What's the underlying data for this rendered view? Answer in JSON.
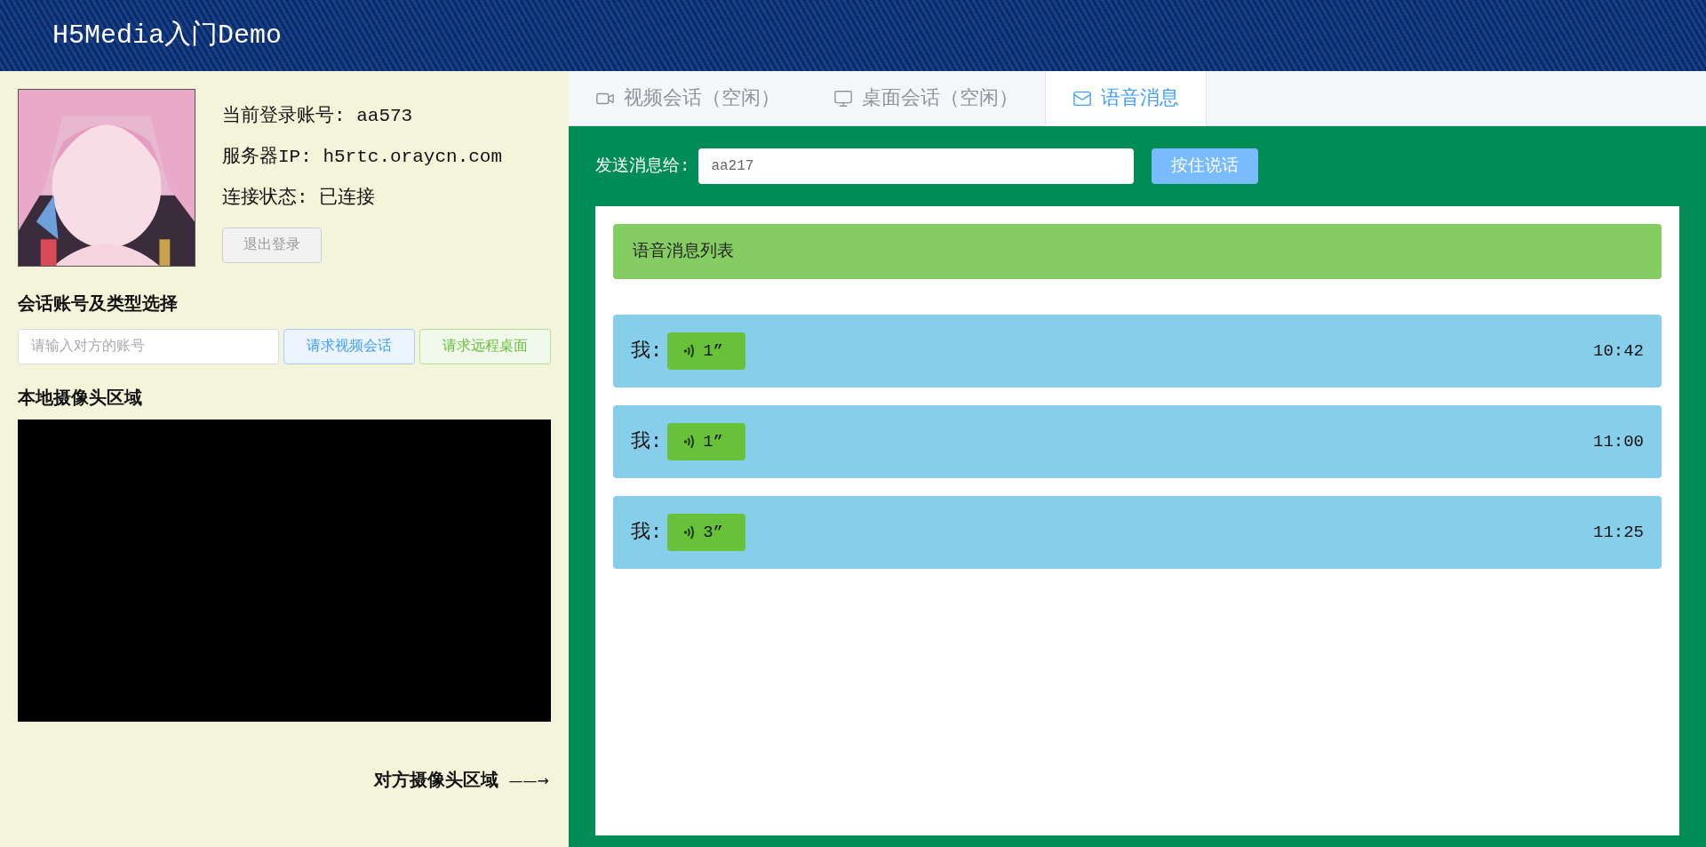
{
  "header": {
    "title": "H5Media入门Demo"
  },
  "account": {
    "info": [
      "当前登录账号: aa573",
      "服务器IP: h5rtc.oraycn.com",
      "连接状态: 已连接"
    ],
    "logout_button": "退出登录"
  },
  "session": {
    "title": "会话账号及类型选择",
    "account_field": {
      "placeholder": "请输入对方的账号"
    },
    "buttons": [
      {
        "label": "请求视频会话",
        "kind": "video"
      },
      {
        "label": "请求远程桌面",
        "kind": "desktop"
      }
    ]
  },
  "local_camera": {
    "title": "本地摄像头区域"
  },
  "remote_camera": {
    "label": "对方摄像头区域",
    "arrow": "——→"
  },
  "tabs": [
    {
      "label": "视频会话（空闲）",
      "kind": "video",
      "selected": false
    },
    {
      "label": "桌面会话（空闲）",
      "kind": "monitor",
      "selected": false
    },
    {
      "label": "语音消息",
      "kind": "mail",
      "selected": true
    }
  ],
  "send": {
    "label": "发送消息给:",
    "recipient": "aa217",
    "talk_button": "按住说话"
  },
  "message_list": {
    "title": "语音消息列表",
    "messages": [
      {
        "sender": "我:",
        "duration": "1”",
        "time": "10:42"
      },
      {
        "sender": "我:",
        "duration": "1”",
        "time": "11:00"
      },
      {
        "sender": "我:",
        "duration": "3”",
        "time": "11:25"
      }
    ]
  }
}
